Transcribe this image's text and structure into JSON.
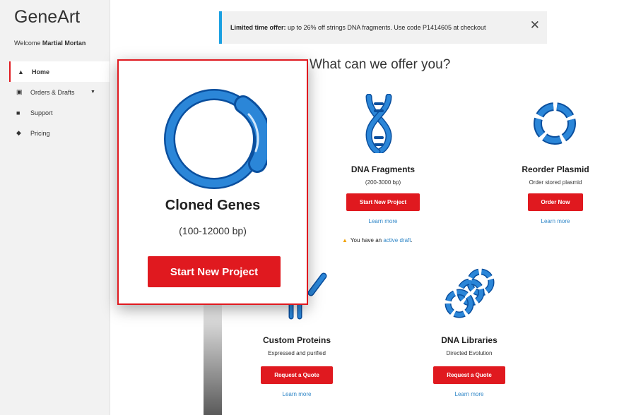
{
  "app": {
    "brand": "GeneArt",
    "welcome_prefix": "Welcome ",
    "user_name": "Martial Mortan"
  },
  "sidebar": {
    "items": [
      {
        "label": "Home",
        "icon": "home-icon"
      },
      {
        "label": "Orders & Drafts",
        "icon": "cart-icon"
      },
      {
        "label": "Support",
        "icon": "chat-icon"
      },
      {
        "label": "Pricing",
        "icon": "tag-icon"
      }
    ]
  },
  "banner": {
    "bold": "Limited time offer:",
    "text": " up to 26% off strings DNA fragments. Use code P1414605 at checkout",
    "close": "✕"
  },
  "main": {
    "heading": "What can we offer you?",
    "products": {
      "dna_fragments": {
        "title": "DNA Fragments",
        "sub": "(200-3000 bp)",
        "button": "Start New Project",
        "link": "Learn more"
      },
      "reorder_plasmid": {
        "title": "Reorder Plasmid",
        "sub": "Order stored plasmid",
        "button": "Order Now",
        "link": "Learn more"
      },
      "custom_proteins": {
        "title": "Custom Proteins",
        "sub": "Expressed and purified",
        "button": "Request a Quote",
        "link": "Learn more"
      },
      "dna_libraries": {
        "title": "DNA Libraries",
        "sub": "Directed Evolution",
        "button": "Request a Quote",
        "link": "Learn more"
      }
    },
    "draft_notice": {
      "prefix": "You have an ",
      "link": "active draft",
      "suffix": "."
    }
  },
  "popup": {
    "title": "Cloned Genes",
    "sub": "(100-12000 bp)",
    "button": "Start New Project"
  },
  "colors": {
    "accent": "#e0191f",
    "icon_blue": "#2b86d8",
    "link": "#2f86c7",
    "banner_bar": "#1ba0e1"
  }
}
